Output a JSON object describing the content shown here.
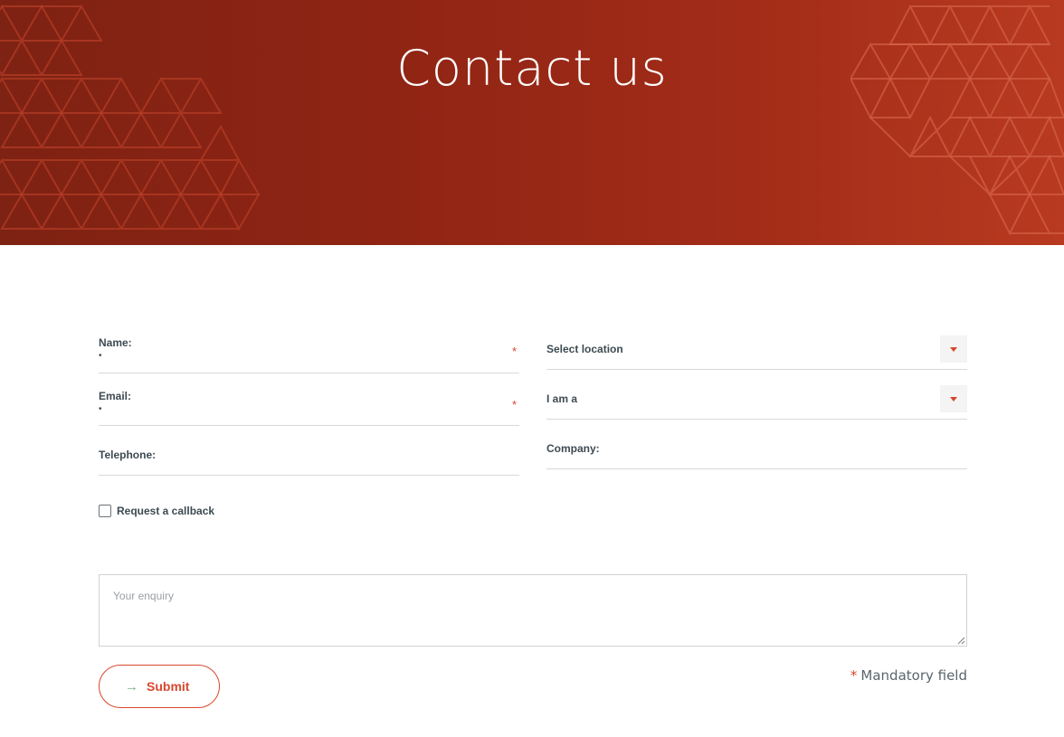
{
  "hero": {
    "title": "Contact us"
  },
  "form": {
    "name": {
      "label": "Name:",
      "marker": "•",
      "required": "*"
    },
    "email": {
      "label": "Email:",
      "marker": "•",
      "required": "*"
    },
    "telephone": {
      "label": "Telephone:"
    },
    "location": {
      "label": "Select location"
    },
    "role": {
      "label": "I am a"
    },
    "company": {
      "label": "Company:"
    },
    "callback": {
      "label": "Request a callback",
      "checked": false
    },
    "enquiry": {
      "placeholder": "Your enquiry"
    },
    "submit": {
      "label": "Submit",
      "arrow": "→"
    },
    "mandatory": {
      "star": "*",
      "text": "Mandatory field"
    }
  },
  "colors": {
    "accent": "#d8472c",
    "hero_start": "#7e2213",
    "hero_end": "#b83a20",
    "arrow": "#7ab58d"
  },
  "icons": {
    "dropdown": "caret-down-icon",
    "submit": "arrow-right-icon"
  }
}
